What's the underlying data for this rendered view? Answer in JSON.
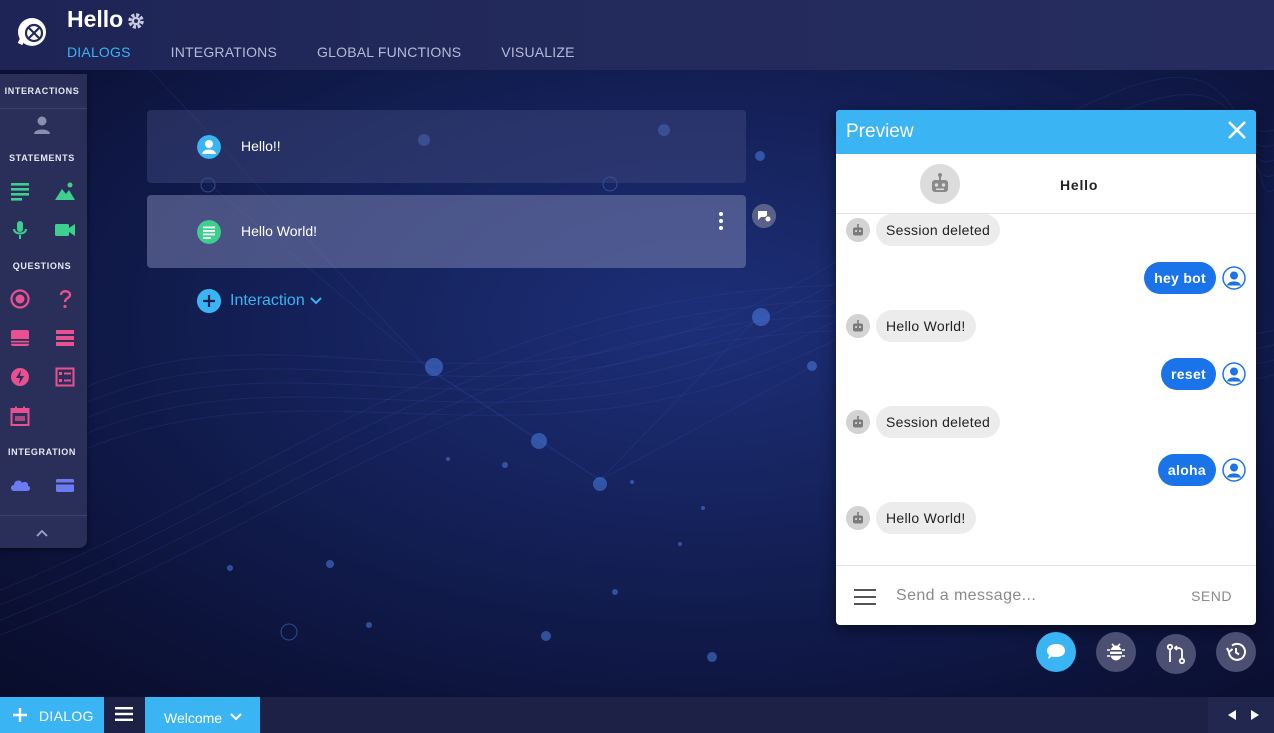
{
  "header": {
    "app_title": "Hello",
    "tabs": [
      {
        "label": "DIALOGS",
        "active": true
      },
      {
        "label": "INTEGRATIONS",
        "active": false
      },
      {
        "label": "GLOBAL FUNCTIONS",
        "active": false
      },
      {
        "label": "VISUALIZE",
        "active": false
      }
    ]
  },
  "palette": {
    "interactions_label": "INTERACTIONS",
    "statements_label": "STATEMENTS",
    "questions_label": "QUESTIONS",
    "integration_label": "INTEGRATION"
  },
  "dialog": {
    "cards": [
      {
        "text": "Hello!!",
        "icon": "user-icon"
      },
      {
        "text": "Hello World!",
        "icon": "text-statement-icon"
      }
    ],
    "add_interaction_label": "Interaction"
  },
  "preview": {
    "title": "Preview",
    "bot_name": "Hello",
    "messages": [
      {
        "from": "bot",
        "text": "Session deleted"
      },
      {
        "from": "user",
        "text": "hey bot"
      },
      {
        "from": "bot",
        "text": "Hello World!"
      },
      {
        "from": "user",
        "text": "reset"
      },
      {
        "from": "bot",
        "text": "Session deleted"
      },
      {
        "from": "user",
        "text": "aloha"
      },
      {
        "from": "bot",
        "text": "Hello World!"
      }
    ],
    "input_placeholder": "Send a message...",
    "send_label": "SEND"
  },
  "bottom_bar": {
    "add_dialog_label": "DIALOG",
    "dialog_tab_label": "Welcome"
  },
  "colors": {
    "accent": "#3ab4f2",
    "user_bubble": "#1a73e8",
    "statement_green": "#3ecf8e",
    "question_pink": "#e8508f",
    "integration_blue": "#6a7cf0"
  }
}
